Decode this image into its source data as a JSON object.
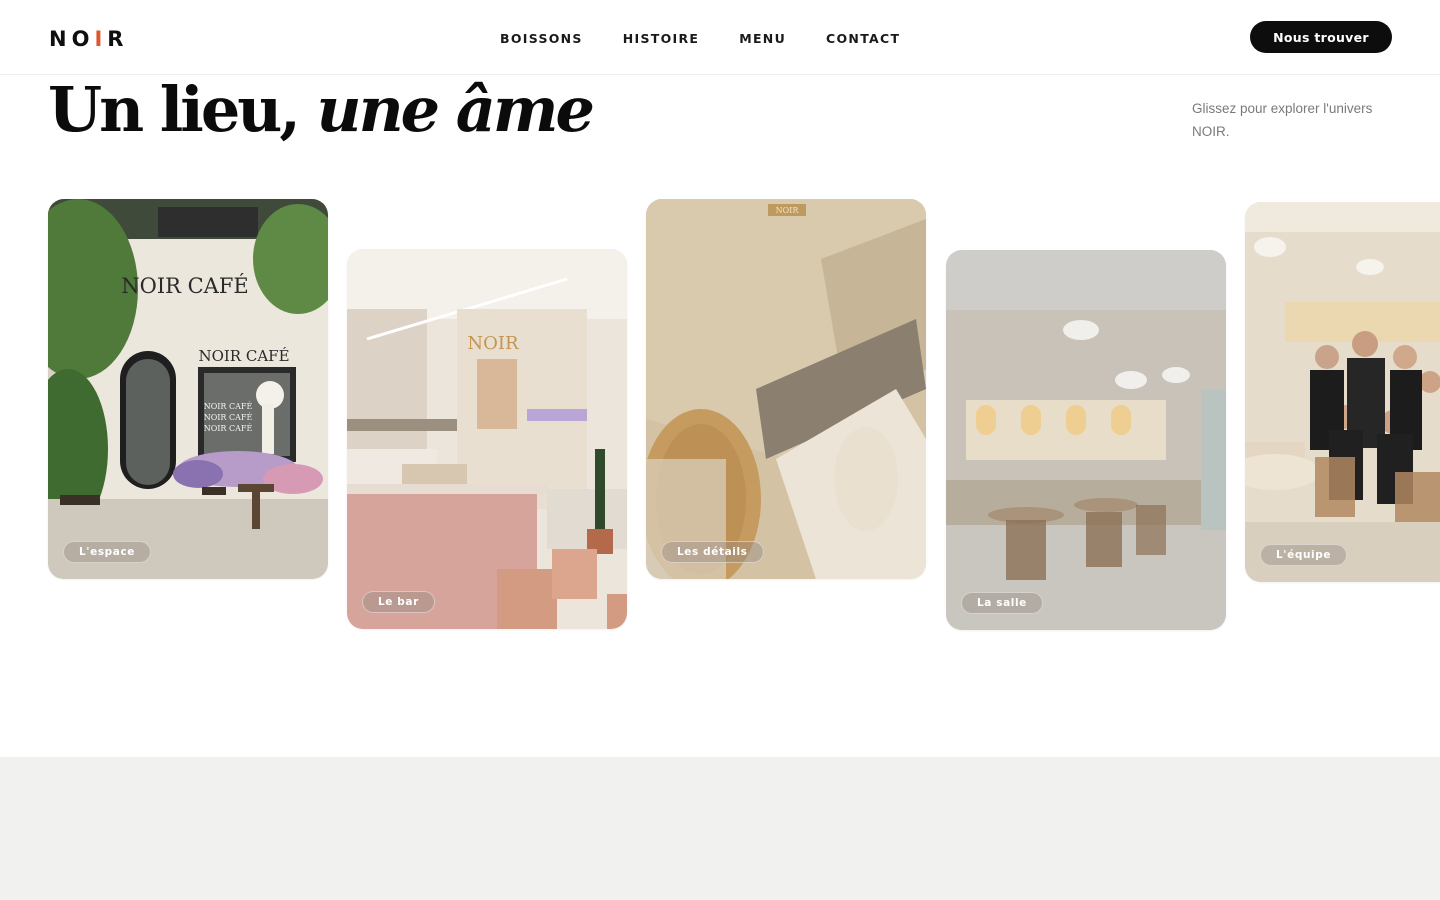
{
  "brand": {
    "logo_pre": "NO",
    "logo_accent": "I",
    "logo_post": "R",
    "accent_color": "#e0562c"
  },
  "nav": {
    "items": [
      "BOISSONS",
      "HISTOIRE",
      "MENU",
      "CONTACT"
    ]
  },
  "header": {
    "cta_label": "Nous trouver"
  },
  "hero": {
    "title_plain": "Un lieu, ",
    "title_italic": "une âme",
    "hint": "Glissez pour explorer l'univers NOIR."
  },
  "gallery": {
    "cards": [
      {
        "label": "L'espace",
        "sign_main": "NOIR CAFÉ",
        "sign_small": "NOIR CAFÉ",
        "window_lines": [
          "NOIR CAFÉ",
          "NOIR CAFÉ",
          "NOIR CAFÉ"
        ]
      },
      {
        "label": "Le bar",
        "sign": "NOIR"
      },
      {
        "label": "Les détails",
        "sign": "NOIR"
      },
      {
        "label": "La salle"
      },
      {
        "label": "L'équipe"
      }
    ]
  }
}
